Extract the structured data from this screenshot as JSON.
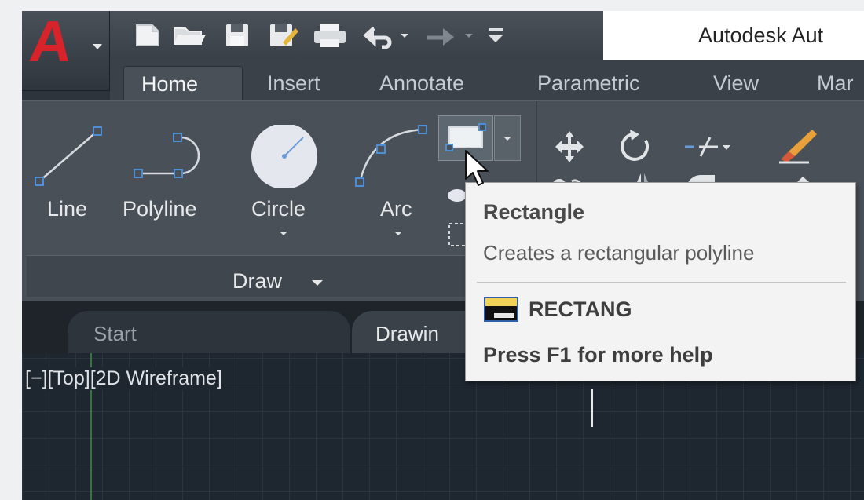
{
  "window": {
    "title": "Autodesk Aut"
  },
  "app_button": {
    "logo_letter": "A",
    "brand_color": "#d8232a"
  },
  "quick_access": {
    "icons": [
      "new-file-icon",
      "open-folder-icon",
      "save-icon",
      "save-as-icon",
      "print-icon",
      "undo-icon",
      "redo-icon",
      "customize-toolbar-icon"
    ]
  },
  "ribbon_tabs": [
    {
      "label": "Home",
      "active": true
    },
    {
      "label": "Insert",
      "active": false
    },
    {
      "label": "Annotate",
      "active": false
    },
    {
      "label": "Parametric",
      "active": false
    },
    {
      "label": "View",
      "active": false
    },
    {
      "label": "Mar",
      "active": false
    }
  ],
  "draw_panel": {
    "title": "Draw",
    "tools": [
      {
        "label": "Line"
      },
      {
        "label": "Polyline"
      },
      {
        "label": "Circle"
      },
      {
        "label": "Arc"
      }
    ]
  },
  "modify_panel": {
    "icons": [
      "move-icon",
      "rotate-icon",
      "trim-icon",
      "erase-icon",
      "copy-icon",
      "mirror-icon",
      "fillet-icon",
      "eraser-icon"
    ]
  },
  "file_tabs": [
    {
      "label": "Start",
      "active": false
    },
    {
      "label": "Drawin",
      "active": true
    }
  ],
  "viewport": {
    "label": "[−][Top][2D Wireframe]",
    "background": "#1e2630",
    "y_axis_color": "#2f7a3a"
  },
  "tooltip": {
    "title": "Rectangle",
    "description": "Creates a rectangular polyline",
    "command": "RECTANG",
    "help": "Press F1 for more help"
  }
}
